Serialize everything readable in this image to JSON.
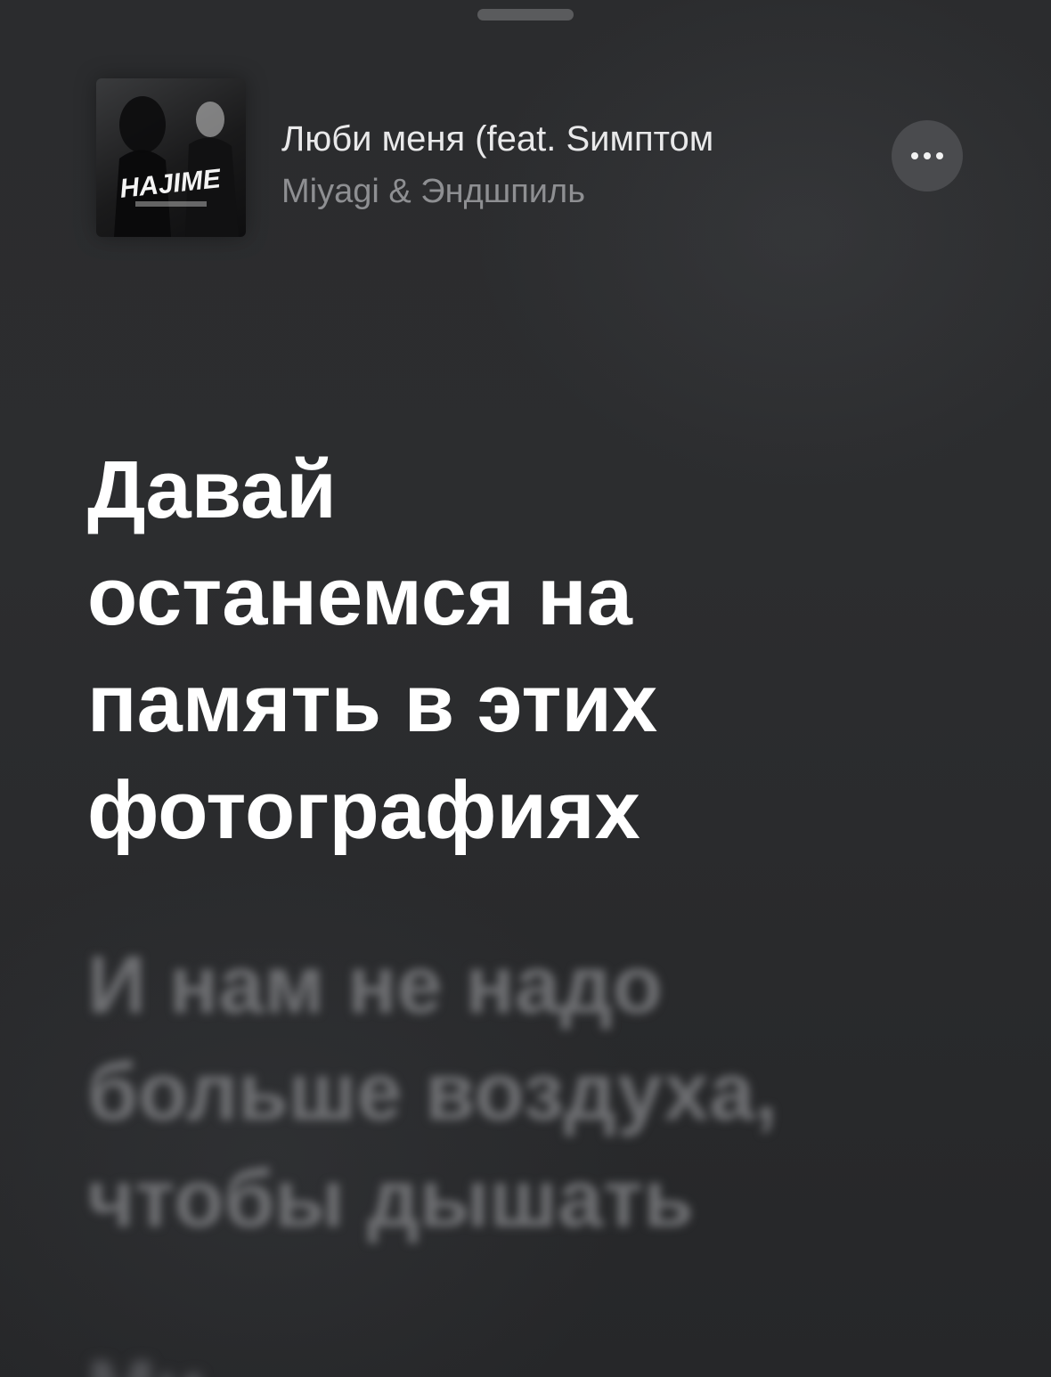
{
  "sheet": {
    "grabber": "drag-handle"
  },
  "now_playing": {
    "artwork_name": "album-artwork",
    "artwork_text": "HAJIME",
    "title": "Люби меня (feat. Sимптом",
    "artist": "Miyagi & Эндшпиль",
    "more_icon": "ellipsis-icon"
  },
  "lyrics": {
    "current": [
      "Давай",
      "останемся на",
      "память в этих",
      "фотографиях"
    ],
    "next": [
      "И нам не надо",
      "больше воздуха,",
      "чтобы дышать"
    ],
    "partial": "Ми"
  },
  "colors": {
    "background": "#2a2b2d",
    "current_lyric": "#ffffff",
    "upcoming_lyric": "#6e6f72",
    "artist_text": "#8e8f92",
    "button_bg": "#4a4b4e"
  }
}
